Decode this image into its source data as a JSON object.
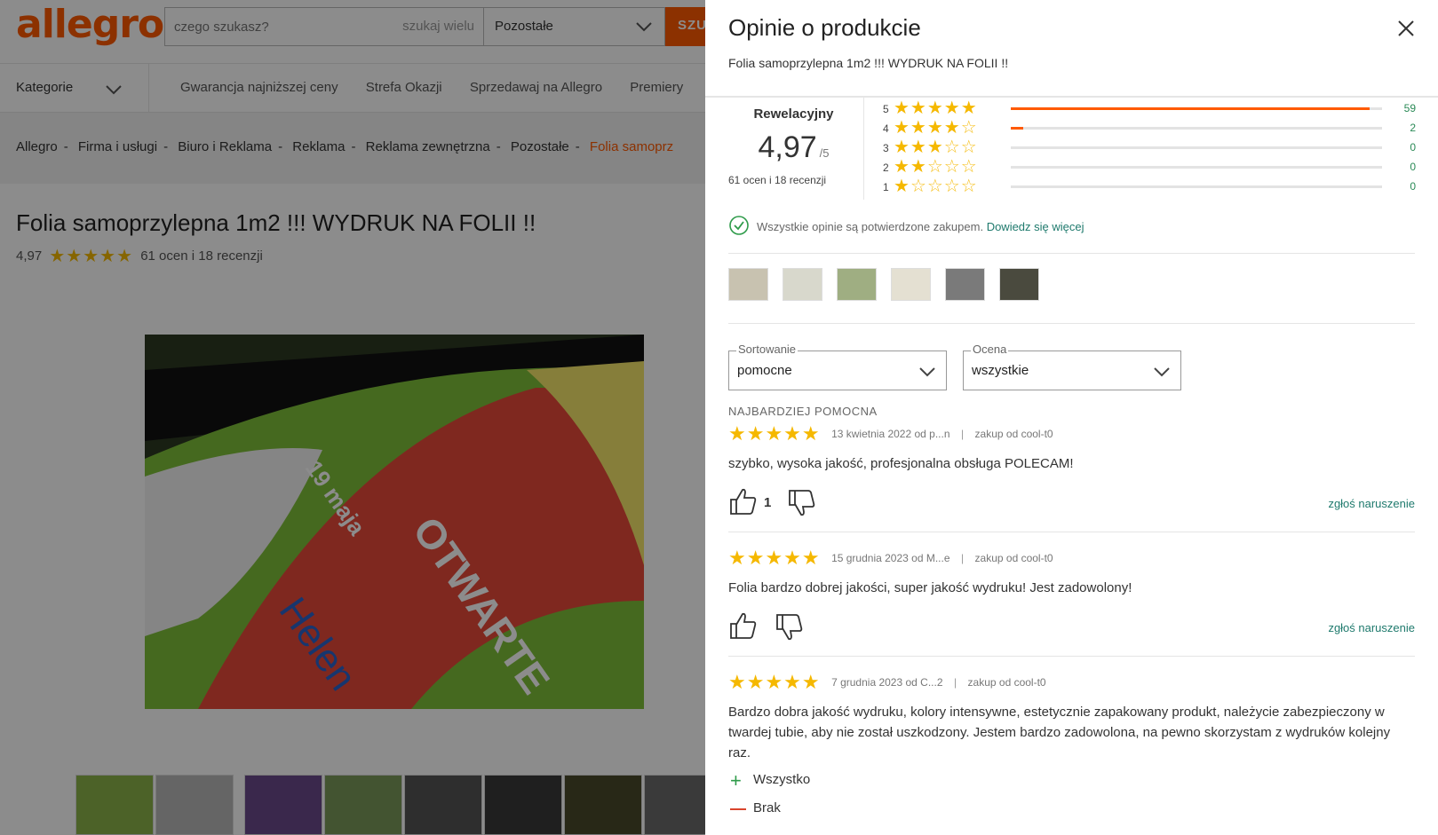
{
  "header": {
    "logo": "allegro",
    "search_placeholder": "czego szukasz?",
    "search_many": "szukaj wielu",
    "category": "Pozostałe",
    "search_button": "SZU"
  },
  "nav": {
    "categories": "Kategorie",
    "links": [
      "Gwarancja najniższej ceny",
      "Strefa Okazji",
      "Sprzedawaj na Allegro",
      "Premiery"
    ]
  },
  "breadcrumbs": [
    "Allegro",
    "Firma i usługi",
    "Biuro i Reklama",
    "Reklama",
    "Reklama zewnętrzna",
    "Pozostałe",
    "Folia samoprz"
  ],
  "product": {
    "title": "Folia samoprzylepna 1m2 !!! WYDRUK NA FOLII !!",
    "rating": "4,97",
    "stars": "★★★★★",
    "ratings_text": "61 ocen i 18 recenzji"
  },
  "drawer": {
    "title": "Opinie o produkcie",
    "subtitle": "Folia samoprzylepna 1m2 !!! WYDRUK NA FOLII !!",
    "summary": {
      "label": "Rewelacyjny",
      "score": "4,97",
      "out_of": "/5",
      "count": "61 ocen i 18 recenzji"
    },
    "distribution": [
      {
        "stars": "5",
        "full": "★★★★★",
        "empty": "",
        "count": "59",
        "fraction": 0.967
      },
      {
        "stars": "4",
        "full": "★★★★",
        "empty": "☆",
        "count": "2",
        "fraction": 0.033
      },
      {
        "stars": "3",
        "full": "★★★",
        "empty": "☆☆",
        "count": "0",
        "fraction": 0
      },
      {
        "stars": "2",
        "full": "★★",
        "empty": "☆☆☆",
        "count": "0",
        "fraction": 0
      },
      {
        "stars": "1",
        "full": "★",
        "empty": "☆☆☆☆",
        "count": "0",
        "fraction": 0
      }
    ],
    "verified_text": "Wszystkie opinie są potwierdzone zakupem.",
    "verified_link": "Dowiedz się więcej",
    "sort": {
      "legend": "Sortowanie",
      "value": "pomocne"
    },
    "filter": {
      "legend": "Ocena",
      "value": "wszystkie"
    },
    "most_helpful": "NAJBARDZIEJ POMOCNA",
    "reviews": [
      {
        "stars": "★★★★★",
        "date": "13 kwietnia 2022 od p...n",
        "from": "zakup od cool-t0",
        "text": "szybko, wysoka jakość, profesjonalna obsługa POLECAM!",
        "likes": "1",
        "report": "zgłoś naruszenie"
      },
      {
        "stars": "★★★★★",
        "date": "15 grudnia 2023 od M...e",
        "from": "zakup od cool-t0",
        "text": "Folia bardzo dobrej jakości, super jakość wydruku! Jest zadowolony!",
        "likes": "",
        "report": "zgłoś naruszenie"
      },
      {
        "stars": "★★★★★",
        "date": "7 grudnia 2023 od C...2",
        "from": "zakup od cool-t0",
        "text": "Bardzo dobra jakość wydruku, kolory intensywne, estetycznie zapakowany produkt, należycie zabezpieczony w twardej tubie, aby nie został uszkodzony. Jestem bardzo zadowolona, na pewno skorzystam z wydruków kolejny raz.",
        "pros": "Wszystko",
        "cons": "Brak"
      }
    ]
  },
  "colors": {
    "brand": "#ff5a00",
    "star": "#f5b800",
    "link": "#1f7a6d"
  }
}
